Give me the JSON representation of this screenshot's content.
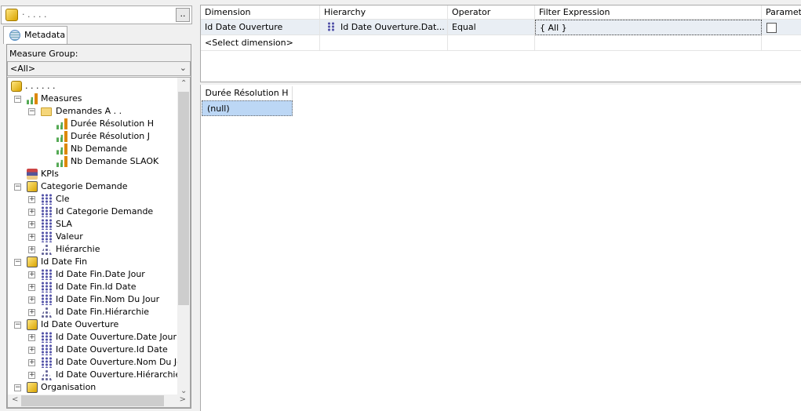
{
  "cube_selector": {
    "value": "· . . . .",
    "button": ".."
  },
  "tab": {
    "label": "Metadata"
  },
  "measure_group": {
    "label": "Measure Group:",
    "value": "<All>"
  },
  "tree": [
    {
      "level": 0,
      "type": "cube",
      "label": ". . . . . .",
      "exp": ""
    },
    {
      "level": 1,
      "type": "meas",
      "label": "Measures",
      "exp": "-"
    },
    {
      "level": 2,
      "type": "folder",
      "label": "Demandes A . .",
      "exp": "-"
    },
    {
      "level": 3,
      "type": "meas",
      "label": "Durée Résolution H",
      "exp": ""
    },
    {
      "level": 3,
      "type": "meas",
      "label": "Durée Résolution J",
      "exp": ""
    },
    {
      "level": 3,
      "type": "meas",
      "label": "Nb Demande",
      "exp": ""
    },
    {
      "level": 3,
      "type": "meas",
      "label": "Nb Demande SLAOK",
      "exp": ""
    },
    {
      "level": 1,
      "type": "kpi",
      "label": "KPIs",
      "exp": ""
    },
    {
      "level": 1,
      "type": "dim",
      "label": "Categorie Demande",
      "exp": "-"
    },
    {
      "level": 2,
      "type": "attr",
      "label": "Cle",
      "exp": "+"
    },
    {
      "level": 2,
      "type": "attr",
      "label": "Id Categorie Demande",
      "exp": "+"
    },
    {
      "level": 2,
      "type": "attr",
      "label": "SLA",
      "exp": "+"
    },
    {
      "level": 2,
      "type": "attr",
      "label": "Valeur",
      "exp": "+"
    },
    {
      "level": 2,
      "type": "hier",
      "label": "Hiérarchie",
      "exp": "+"
    },
    {
      "level": 1,
      "type": "dim",
      "label": "Id Date Fin",
      "exp": "-"
    },
    {
      "level": 2,
      "type": "attr",
      "label": "Id Date Fin.Date Jour",
      "exp": "+"
    },
    {
      "level": 2,
      "type": "attr",
      "label": "Id Date Fin.Id Date",
      "exp": "+"
    },
    {
      "level": 2,
      "type": "attr",
      "label": "Id Date Fin.Nom Du Jour",
      "exp": "+"
    },
    {
      "level": 2,
      "type": "hier",
      "label": "Id Date Fin.Hiérarchie",
      "exp": "+"
    },
    {
      "level": 1,
      "type": "dim",
      "label": "Id Date Ouverture",
      "exp": "-"
    },
    {
      "level": 2,
      "type": "attr",
      "label": "Id Date Ouverture.Date Jour",
      "exp": "+"
    },
    {
      "level": 2,
      "type": "attr",
      "label": "Id Date Ouverture.Id Date",
      "exp": "+"
    },
    {
      "level": 2,
      "type": "attr",
      "label": "Id Date Ouverture.Nom Du Jour",
      "exp": "+"
    },
    {
      "level": 2,
      "type": "hier",
      "label": "Id Date Ouverture.Hiérarchie",
      "exp": "+"
    },
    {
      "level": 1,
      "type": "dim",
      "label": "Organisation",
      "exp": "-"
    }
  ],
  "filter_grid": {
    "headers": [
      "Dimension",
      "Hierarchy",
      "Operator",
      "Filter Expression",
      "Paramet"
    ],
    "rows": [
      {
        "dimension": "Id Date Ouverture",
        "hierarchy": "Id Date Ouverture.Dat...",
        "operator": "Equal",
        "expression": "{ All }",
        "parameter": false
      },
      {
        "dimension": "<Select dimension>",
        "hierarchy": "",
        "operator": "",
        "expression": ""
      }
    ]
  },
  "results": {
    "header": "Durée Résolution H",
    "value": "(null)"
  },
  "colors": {
    "selection": "#bcd7f5",
    "row_highlight": "#e9eef4"
  }
}
